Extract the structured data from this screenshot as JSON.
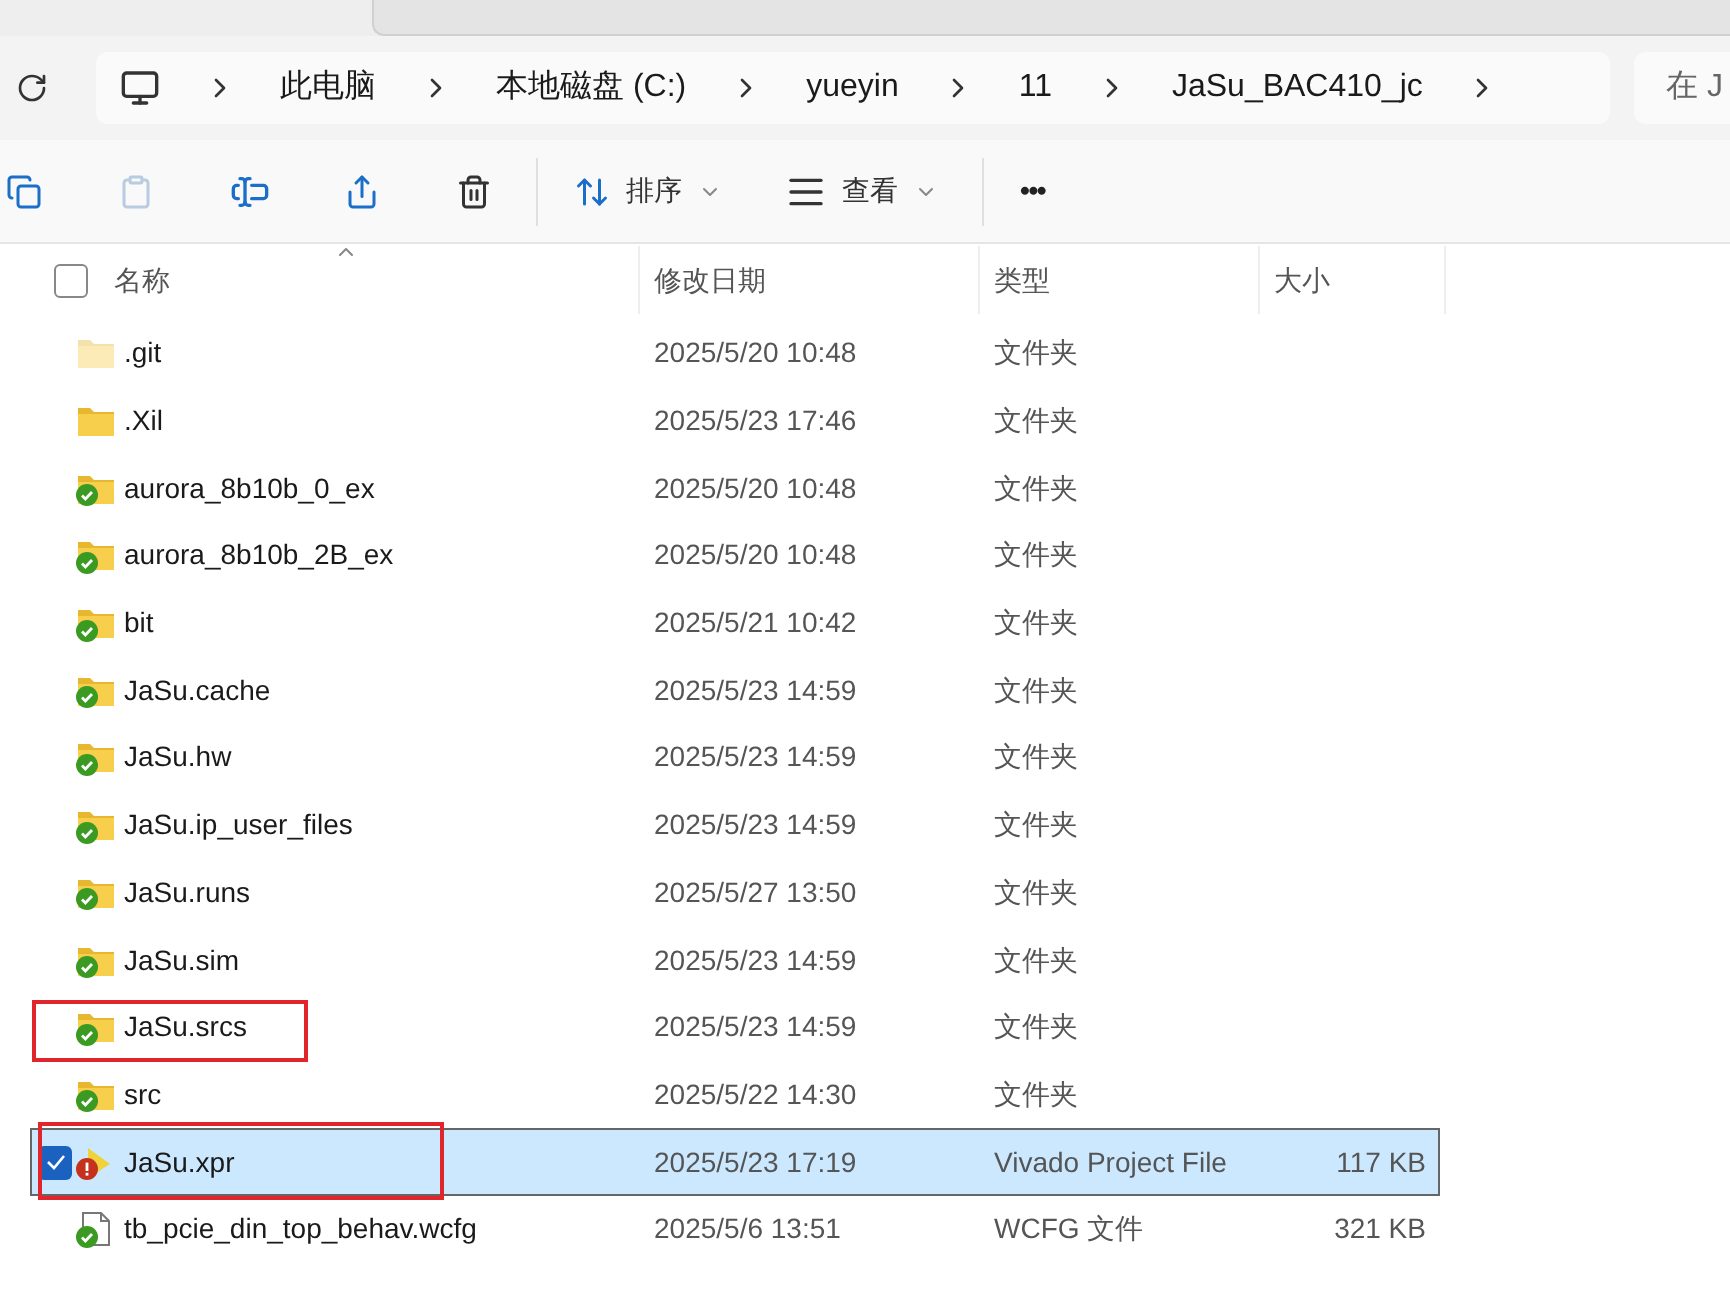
{
  "breadcrumb": [
    "此电脑",
    "本地磁盘 (C:)",
    "yueyin",
    "11",
    "JaSu_BAC410_jc"
  ],
  "search": {
    "placeholder": "在 J"
  },
  "select_all": {
    "checked": false
  },
  "toolbar": {
    "sort": "排序",
    "view": "查看",
    "more": "•••"
  },
  "columns": [
    "名称",
    "修改日期",
    "类型",
    "大小"
  ],
  "rows": [
    {
      "kind": "folder",
      "synced": false,
      "error": false,
      "faded": true,
      "name": ".git",
      "date": "2025/5/20 10:48",
      "type": "文件夹",
      "selected": false,
      "annotated": false
    },
    {
      "kind": "folder",
      "synced": false,
      "error": false,
      "faded": false,
      "name": ".Xil",
      "date": "2025/5/23 17:46",
      "type": "文件夹",
      "selected": false,
      "annotated": false
    },
    {
      "kind": "folder",
      "synced": true,
      "error": false,
      "faded": false,
      "name": "aurora_8b10b_0_ex",
      "date": "2025/5/20 10:48",
      "type": "文件夹",
      "selected": false,
      "annotated": false
    },
    {
      "kind": "folder",
      "synced": true,
      "error": false,
      "faded": false,
      "name": "aurora_8b10b_2B_ex",
      "date": "2025/5/20 10:48",
      "type": "文件夹",
      "selected": false,
      "annotated": false
    },
    {
      "kind": "folder",
      "synced": true,
      "error": false,
      "faded": false,
      "name": "bit",
      "date": "2025/5/21 10:42",
      "type": "文件夹",
      "selected": false,
      "annotated": false
    },
    {
      "kind": "folder",
      "synced": true,
      "error": false,
      "faded": false,
      "name": "JaSu.cache",
      "date": "2025/5/23 14:59",
      "type": "文件夹",
      "selected": false,
      "annotated": false
    },
    {
      "kind": "folder",
      "synced": true,
      "error": false,
      "faded": false,
      "name": "JaSu.hw",
      "date": "2025/5/23 14:59",
      "type": "文件夹",
      "selected": false,
      "annotated": false
    },
    {
      "kind": "folder",
      "synced": true,
      "error": false,
      "faded": false,
      "name": "JaSu.ip_user_files",
      "date": "2025/5/23 14:59",
      "type": "文件夹",
      "selected": false,
      "annotated": false
    },
    {
      "kind": "folder",
      "synced": true,
      "error": false,
      "faded": false,
      "name": "JaSu.runs",
      "date": "2025/5/27 13:50",
      "type": "文件夹",
      "selected": false,
      "annotated": false
    },
    {
      "kind": "folder",
      "synced": true,
      "error": false,
      "faded": false,
      "name": "JaSu.sim",
      "date": "2025/5/23 14:59",
      "type": "文件夹",
      "selected": false,
      "annotated": false
    },
    {
      "kind": "folder",
      "synced": true,
      "error": false,
      "faded": false,
      "name": "JaSu.srcs",
      "date": "2025/5/23 14:59",
      "type": "文件夹",
      "selected": false,
      "annotated": true
    },
    {
      "kind": "folder",
      "synced": true,
      "error": false,
      "faded": false,
      "name": "src",
      "date": "2025/5/22 14:30",
      "type": "文件夹",
      "selected": false,
      "annotated": false
    },
    {
      "kind": "project",
      "synced": false,
      "error": true,
      "faded": false,
      "name": "JaSu.xpr",
      "date": "2025/5/23 17:19",
      "type": "Vivado Project File",
      "size": "117 KB",
      "selected": true,
      "annotated": true
    },
    {
      "kind": "file",
      "synced": true,
      "error": false,
      "faded": false,
      "name": "tb_pcie_din_top_behav.wcfg",
      "date": "2025/5/6 13:51",
      "type": "WCFG 文件",
      "size": "321 KB",
      "selected": false,
      "annotated": false
    }
  ]
}
